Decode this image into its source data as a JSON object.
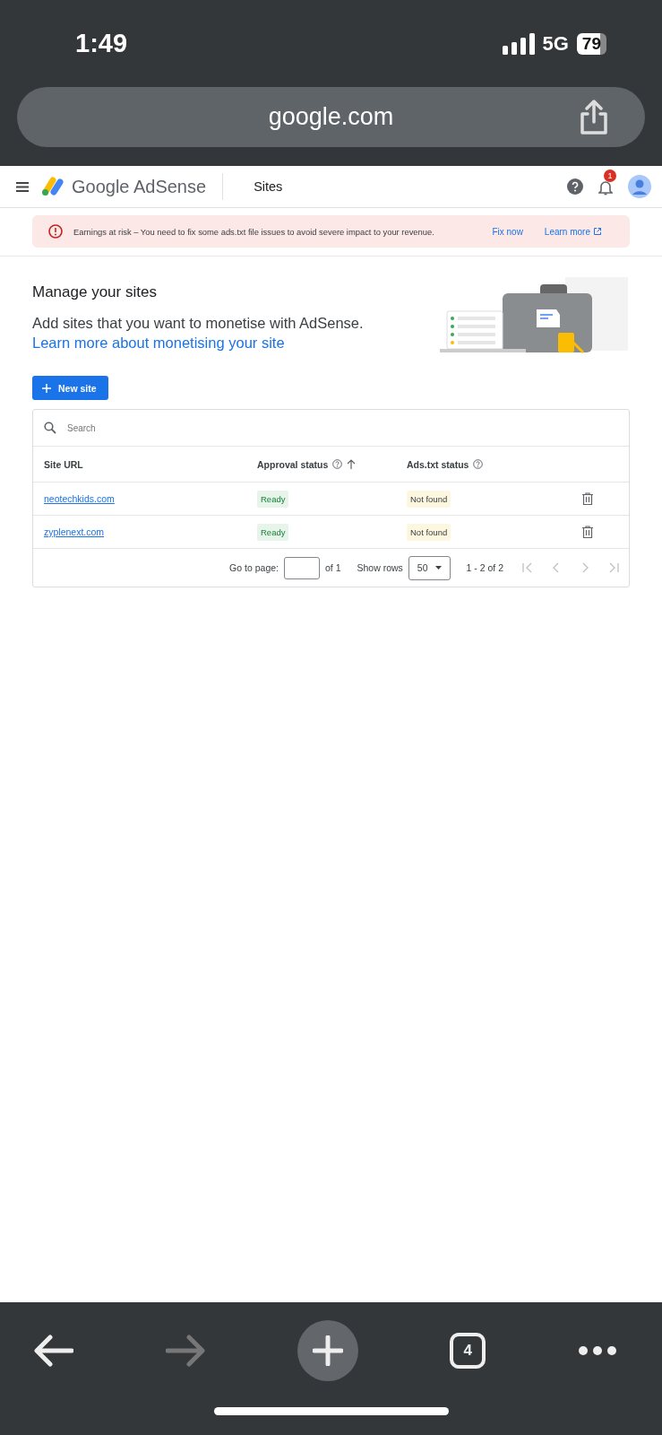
{
  "status_bar": {
    "time": "1:49",
    "network": "5G",
    "battery": "79"
  },
  "address_bar": {
    "url": "google.com"
  },
  "header": {
    "product": "Google AdSense",
    "page": "Sites",
    "notification_count": "1"
  },
  "alert": {
    "message": "Earnings at risk – You need to fix some ads.txt file issues to avoid severe impact to your revenue.",
    "actions": [
      "Fix now",
      "Learn more"
    ]
  },
  "intro": {
    "title": "Manage your sites",
    "text": "Add sites that you want to monetise with AdSense. ",
    "link": "Learn more about monetising your site"
  },
  "new_site_button": "New site",
  "table": {
    "search": {
      "placeholder": "Search"
    },
    "columns": [
      {
        "label": "Site URL",
        "help": false,
        "sorted": false
      },
      {
        "label": "Approval status",
        "help": true,
        "sorted": true
      },
      {
        "label": "Ads.txt status",
        "help": true,
        "sorted": false
      }
    ],
    "rows": [
      {
        "url": "neotechkids.com",
        "approval": "Ready",
        "ads_txt": "Not found"
      },
      {
        "url": "zyplenext.com",
        "approval": "Ready",
        "ads_txt": "Not found"
      }
    ],
    "pagination": {
      "go_to_label": "Go to page:",
      "of": "of 1",
      "show_rows_label": "Show rows",
      "rows": "50",
      "range": "1 - 2 of 2"
    }
  },
  "toolbar": {
    "tab_count": "4",
    "back_disabled": false,
    "forward_disabled": true
  }
}
